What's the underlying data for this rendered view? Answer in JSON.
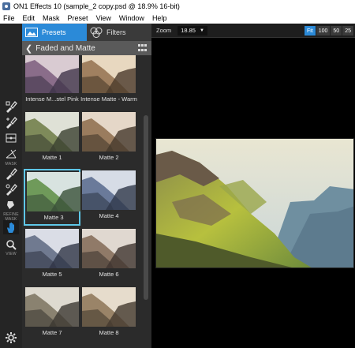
{
  "window": {
    "title": "ON1 Effects 10 (sample_2 copy.psd @ 18.9% 16-bit)"
  },
  "menu": [
    "File",
    "Edit",
    "Mask",
    "Preset",
    "View",
    "Window",
    "Help"
  ],
  "tools": {
    "mask_label": "MASK",
    "refine_label": "REFINE MASK",
    "view_label": "VIEW"
  },
  "panel": {
    "tabs": [
      {
        "label": "Presets"
      },
      {
        "label": "Filters"
      }
    ],
    "category": "Faded and Matte",
    "presets": [
      {
        "label": "Intense M...stel Pink"
      },
      {
        "label": "Intense Matte - Warm"
      },
      {
        "label": "Matte 1"
      },
      {
        "label": "Matte 2"
      },
      {
        "label": "Matte 3"
      },
      {
        "label": "Matte 4"
      },
      {
        "label": "Matte 5"
      },
      {
        "label": "Matte 6"
      },
      {
        "label": "Matte 7"
      },
      {
        "label": "Matte 8"
      }
    ],
    "selected_preset": "Matte 3"
  },
  "zoom": {
    "label": "Zoom",
    "value": "18.85",
    "buttons": [
      "Fit",
      "100",
      "50",
      "25"
    ],
    "active": "Fit"
  },
  "colors": {
    "accent": "#2b8ad8",
    "selection": "#5ec7e8",
    "panel": "#2b2b2b"
  }
}
